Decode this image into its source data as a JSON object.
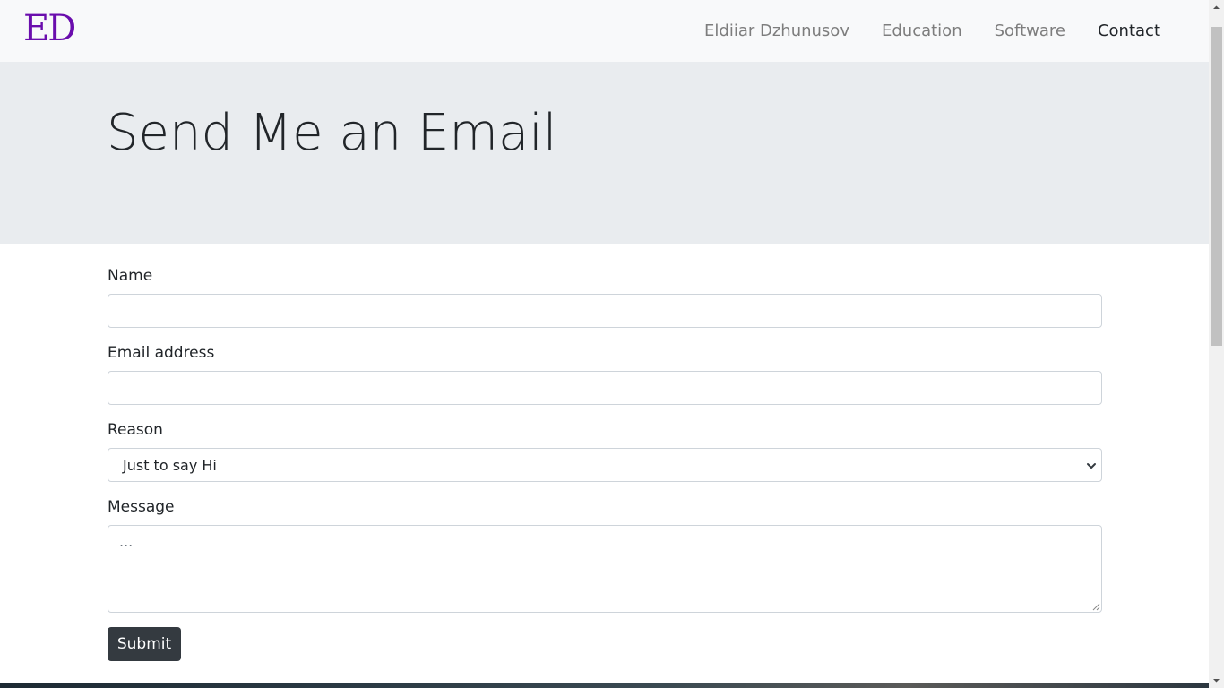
{
  "navbar": {
    "brand": "ED",
    "brand_color": "#6a0dad",
    "links": [
      {
        "label": "Eldiiar Dzhunusov",
        "active": false
      },
      {
        "label": "Education",
        "active": false
      },
      {
        "label": "Software",
        "active": false
      },
      {
        "label": "Contact",
        "active": true
      }
    ]
  },
  "hero": {
    "title": "Send Me an Email"
  },
  "form": {
    "name_label": "Name",
    "name_value": "",
    "email_label": "Email address",
    "email_value": "",
    "reason_label": "Reason",
    "reason_selected": "Just to say Hi",
    "message_label": "Message",
    "message_placeholder": "...",
    "submit_label": "Submit"
  },
  "colors": {
    "navbar_bg": "#f8f9fa",
    "hero_bg": "#e9ecef",
    "button_bg": "#343a40"
  }
}
